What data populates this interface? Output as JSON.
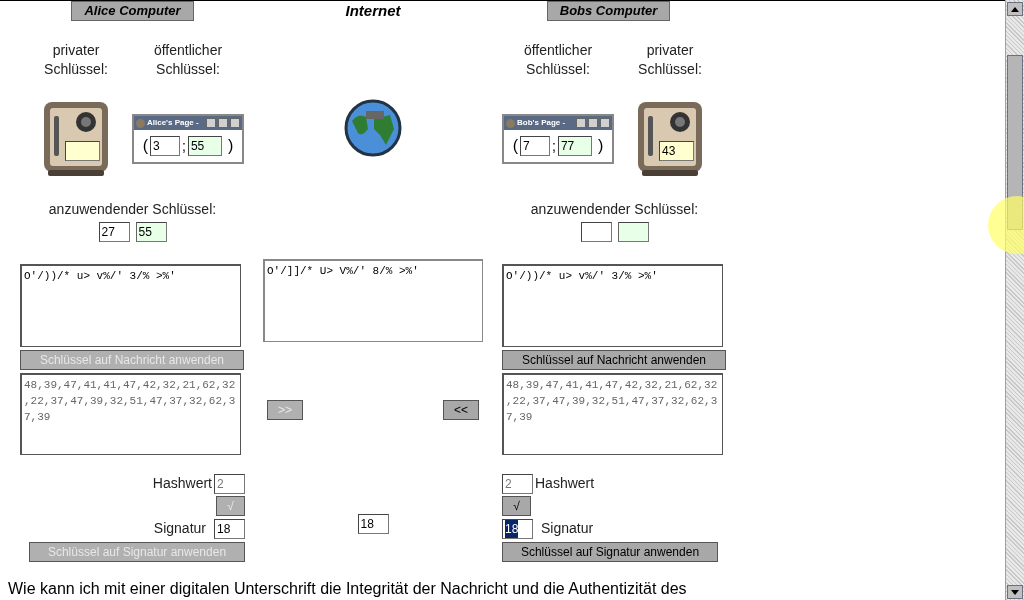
{
  "alice": {
    "heading": "Alice Computer",
    "private_label": "privater Schlüssel:",
    "public_label": "öffentlicher Schlüssel:",
    "key_window": {
      "title": "Alice's Page -",
      "open": "(",
      "sep": ";",
      "close": ")",
      "e": "3",
      "n": "55"
    },
    "apply_label": "anzuwendender Schlüssel:",
    "apply_key": [
      {
        "kind": "plain",
        "value": "27"
      },
      {
        "kind": "green",
        "value": "55"
      }
    ],
    "message": "O'/))/* u> v%/' 3/% >%'",
    "apply_message_button": {
      "label": "Schlüssel auf Nachricht anwenden",
      "disabled": true
    },
    "codes": "48,39,47,41,41,47,42,32,21,62,32,22,37,47,39,32,51,47,37,32,62,37,39",
    "hash": {
      "label": "Hashwert",
      "value": "2"
    },
    "hash_button": {
      "label": "√",
      "disabled": true
    },
    "signature": {
      "label": "Signatur",
      "value": "18",
      "selected": false
    },
    "apply_signature_button": {
      "label": "Schlüssel auf Signatur anwenden",
      "disabled": true
    }
  },
  "internet": {
    "heading": "Internet",
    "message": "O'/]]/* U> V%/' 8/% >%'",
    "forward_button": {
      "label": ">>",
      "disabled": true
    },
    "back_button": {
      "label": "<<",
      "disabled": false
    },
    "signature": "18"
  },
  "bob": {
    "heading": "Bobs Computer",
    "private_label": "privater Schlüssel:",
    "public_label": "öffentlicher Schlüssel:",
    "safe_value": "43",
    "key_window": {
      "title": "Bob's Page -",
      "open": "(",
      "sep": ";",
      "close": ")",
      "e": "7",
      "n": "77"
    },
    "apply_label": "anzuwendender Schlüssel:",
    "apply_key": [
      {
        "kind": "plain"
      },
      {
        "kind": "green"
      }
    ],
    "message": "O'/))/* u> v%/' 3/% >%'",
    "apply_message_button": {
      "label": "Schlüssel auf Nachricht anwenden",
      "disabled": false
    },
    "codes": "48,39,47,41,41,47,42,32,21,62,32,22,37,47,39,32,51,47,37,32,62,37,39",
    "hash": {
      "label": "Hashwert",
      "value": "2"
    },
    "hash_button": {
      "label": "√",
      "disabled": false
    },
    "signature": {
      "label": "Signatur",
      "value": "18",
      "selected": true
    },
    "apply_signature_button": {
      "label": "Schlüssel auf Signatur anwenden",
      "disabled": false
    }
  },
  "bottom_text": "Wie kann ich mit einer digitalen Unterschrift die Integrität der Nachricht und die Authentizität des"
}
